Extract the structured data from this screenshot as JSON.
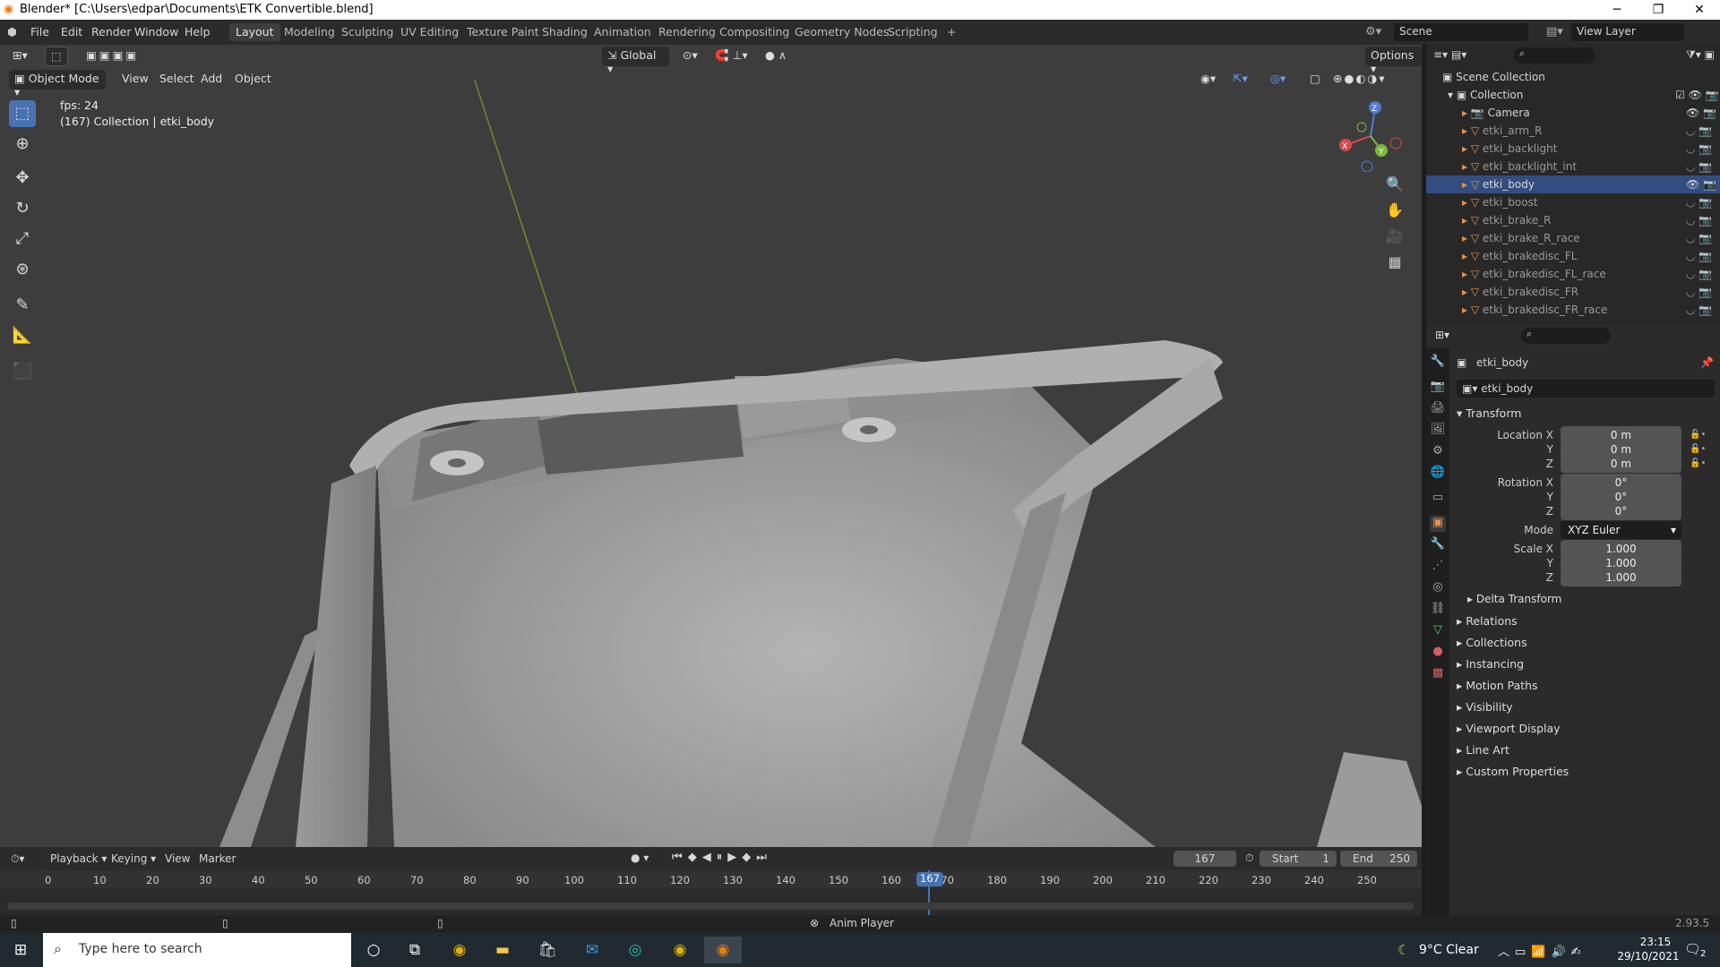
{
  "window": {
    "title": "Blender* [C:\\Users\\edpar\\Documents\\ETK Convertible.blend]",
    "min": "─",
    "max": "❐",
    "close": "✕"
  },
  "menus": [
    "File",
    "Edit",
    "Render",
    "Window",
    "Help"
  ],
  "workspaces": [
    "Layout",
    "Modeling",
    "Sculpting",
    "UV Editing",
    "Texture Paint",
    "Shading",
    "Animation",
    "Rendering",
    "Compositing",
    "Geometry Nodes",
    "Scripting"
  ],
  "scene": "Scene",
  "view_layer": "View Layer",
  "viewport": {
    "mode": "Object Mode",
    "menus": [
      "View",
      "Select",
      "Add",
      "Object"
    ],
    "orientation": "Global",
    "options": "Options",
    "fps": "fps: 24",
    "info": "(167) Collection | etki_body",
    "gizmo": {
      "z": "Z",
      "y": "Y",
      "x": "X"
    }
  },
  "outliner": {
    "root": "Scene Collection",
    "collection": "Collection",
    "items": [
      "Camera",
      "etki_arm_R",
      "etki_backlight",
      "etki_backlight_int",
      "etki_body",
      "etki_boost",
      "etki_brake_R",
      "etki_brake_R_race",
      "etki_brakedisc_FL",
      "etki_brakedisc_FL_race",
      "etki_brakedisc_FR",
      "etki_brakedisc_FR_race"
    ]
  },
  "props": {
    "object": "etki_body",
    "name_field": "etki_body",
    "transform": "Transform",
    "location": {
      "label": "Location X",
      "x": "0 m",
      "y": "0 m",
      "z": "0 m"
    },
    "rotation": {
      "label": "Rotation X",
      "x": "0°",
      "y": "0°",
      "z": "0°"
    },
    "mode_label": "Mode",
    "mode": "XYZ Euler",
    "scale": {
      "label": "Scale X",
      "x": "1.000",
      "y": "1.000",
      "z": "1.000"
    },
    "axis_y": "Y",
    "axis_z": "Z",
    "sections": [
      "Delta Transform",
      "Relations",
      "Collections",
      "Instancing",
      "Motion Paths",
      "Visibility",
      "Viewport Display",
      "Line Art",
      "Custom Properties"
    ]
  },
  "timeline": {
    "menus": [
      "Playback",
      "Keying",
      "View",
      "Marker"
    ],
    "current": "167",
    "start_label": "Start",
    "start": "1",
    "end_label": "End",
    "end": "250",
    "ticks": [
      "0",
      "10",
      "20",
      "30",
      "40",
      "50",
      "60",
      "70",
      "80",
      "90",
      "100",
      "110",
      "120",
      "130",
      "140",
      "150",
      "160",
      "170",
      "180",
      "190",
      "200",
      "210",
      "220",
      "230",
      "240",
      "250"
    ]
  },
  "status": {
    "center": "Anim Player",
    "version": "2.93.5"
  },
  "taskbar": {
    "search": "Type here to search",
    "weather": "9°C  Clear",
    "time": "23:15",
    "date": "29/10/2021",
    "notif": "2"
  }
}
